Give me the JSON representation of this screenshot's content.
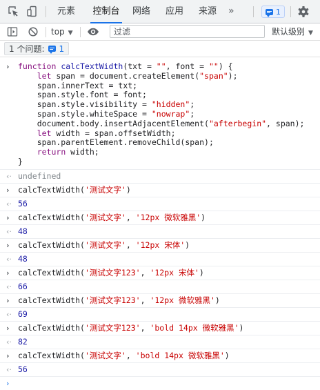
{
  "tabs": [
    "元素",
    "控制台",
    "网络",
    "应用",
    "来源"
  ],
  "more_glyph": "»",
  "issues_badge_count": "1",
  "toolbar": {
    "context": "top",
    "filter_placeholder": "过滤",
    "level": "默认级别"
  },
  "issues_bar": {
    "label": "1 个问题:",
    "count": "1"
  },
  "icons": [
    "inspect-icon",
    "device-toolbar-icon",
    "settings-gear-icon",
    "sidebar-toggle-icon",
    "clear-console-icon",
    "eye-icon",
    "message-icon"
  ],
  "colors": {
    "accent": "#1a73e8",
    "keyword": "#881280",
    "string": "#c80000",
    "number": "#1a1aa6"
  },
  "console": {
    "function_lines": [
      [
        [
          "kw",
          "function "
        ],
        [
          "fn",
          "calcTextWidth"
        ],
        [
          "pl",
          "(txt = "
        ],
        [
          "st",
          "\"\""
        ],
        [
          "pl",
          ", font = "
        ],
        [
          "st",
          "\"\""
        ],
        [
          "pl",
          ") {"
        ]
      ],
      [
        [
          "pl",
          "    "
        ],
        [
          "kw",
          "let "
        ],
        [
          "pl",
          "span = document.createElement("
        ],
        [
          "st",
          "\"span\""
        ],
        [
          "pl",
          ");"
        ]
      ],
      [
        [
          "pl",
          "    span.innerText = txt;"
        ]
      ],
      [
        [
          "pl",
          "    span.style.font = font;"
        ]
      ],
      [
        [
          "pl",
          "    span.style.visibility = "
        ],
        [
          "st",
          "\"hidden\""
        ],
        [
          "pl",
          ";"
        ]
      ],
      [
        [
          "pl",
          "    span.style.whiteSpace = "
        ],
        [
          "st",
          "\"nowrap\""
        ],
        [
          "pl",
          ";"
        ]
      ],
      [
        [
          "pl",
          "    document.body.insertAdjacentElement("
        ],
        [
          "st",
          "\"afterbegin\""
        ],
        [
          "pl",
          ", span);"
        ]
      ],
      [
        [
          "pl",
          "    "
        ],
        [
          "kw",
          "let "
        ],
        [
          "pl",
          "width = span.offsetWidth;"
        ]
      ],
      [
        [
          "pl",
          "    span.parentElement.removeChild(span);"
        ]
      ],
      [
        [
          "pl",
          "    "
        ],
        [
          "kw",
          "return "
        ],
        [
          "pl",
          "width;"
        ]
      ],
      [
        [
          "pl",
          "}"
        ]
      ]
    ],
    "function_result": "undefined",
    "calls": [
      {
        "args": [
          [
            "st",
            "'测试文字'"
          ]
        ],
        "result": "56"
      },
      {
        "args": [
          [
            "st",
            "'测试文字'"
          ],
          [
            "pl",
            ", "
          ],
          [
            "st",
            "'12px 微软雅黑'"
          ]
        ],
        "result": "48"
      },
      {
        "args": [
          [
            "st",
            "'测试文字'"
          ],
          [
            "pl",
            ", "
          ],
          [
            "st",
            "'12px 宋体'"
          ]
        ],
        "result": "48"
      },
      {
        "args": [
          [
            "st",
            "'测试文字123'"
          ],
          [
            "pl",
            ", "
          ],
          [
            "st",
            "'12px 宋体'"
          ]
        ],
        "result": "66"
      },
      {
        "args": [
          [
            "st",
            "'测试文字123'"
          ],
          [
            "pl",
            ", "
          ],
          [
            "st",
            "'12px 微软雅黑'"
          ]
        ],
        "result": "69"
      },
      {
        "args": [
          [
            "st",
            "'测试文字123'"
          ],
          [
            "pl",
            ", "
          ],
          [
            "st",
            "'bold 14px 微软雅黑'"
          ]
        ],
        "result": "82"
      },
      {
        "args": [
          [
            "st",
            "'测试文字'"
          ],
          [
            "pl",
            ", "
          ],
          [
            "st",
            "'bold 14px 微软雅黑'"
          ]
        ],
        "result": "56"
      }
    ],
    "call_name": "calcTextWidth",
    "prompt_glyph": "›",
    "result_glyph": "‹·"
  }
}
